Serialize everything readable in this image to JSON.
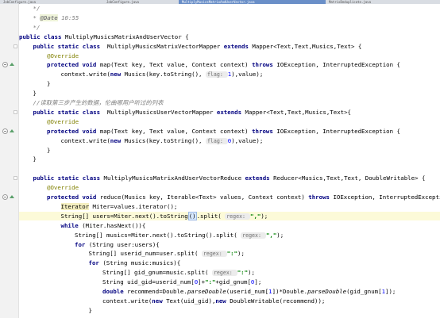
{
  "tabs": [
    {
      "label": "JobConfigure.java",
      "active": false
    },
    {
      "label": "JobConfigure.java",
      "active": false
    },
    {
      "label": "MultiplyMusicsMatrixAndUserVector.java",
      "active": true
    },
    {
      "label": "MatrixDeduplicate.java",
      "active": false
    }
  ],
  "lines": [
    {
      "gutter": "",
      "fold": false,
      "hl": false,
      "indent": 1,
      "tokens": [
        {
          "t": "*/",
          "c": "doc"
        }
      ]
    },
    {
      "gutter": "",
      "fold": false,
      "hl": false,
      "indent": 1,
      "tokens": [
        {
          "t": "* ",
          "c": "doc"
        },
        {
          "t": "@Date",
          "c": "doctag"
        },
        {
          "t": " 10:55",
          "c": "doc"
        }
      ]
    },
    {
      "gutter": "",
      "fold": false,
      "hl": false,
      "indent": 1,
      "tokens": [
        {
          "t": "*/",
          "c": "doc"
        }
      ]
    },
    {
      "gutter": "",
      "fold": false,
      "hl": false,
      "indent": 0,
      "tokens": [
        {
          "t": "public class ",
          "c": "kw"
        },
        {
          "t": "MultiplyMusicsMatrixAndUserVector {",
          "c": ""
        }
      ]
    },
    {
      "gutter": "",
      "fold": false,
      "hl": false,
      "indent": 1,
      "tokens": [
        {
          "t": "public static class ",
          "c": "kw"
        },
        {
          "t": " MultiplyMusicsMatrixVectorMapper ",
          "c": ""
        },
        {
          "t": "extends ",
          "c": "kw"
        },
        {
          "t": "Mapper<Text,Text,Musics,Text> {",
          "c": ""
        }
      ]
    },
    {
      "gutter": "",
      "fold": false,
      "hl": false,
      "indent": 2,
      "tokens": [
        {
          "t": "@Override",
          "c": "ann"
        }
      ]
    },
    {
      "gutter": "override",
      "fold": false,
      "hl": false,
      "indent": 2,
      "tokens": [
        {
          "t": "protected void ",
          "c": "kw"
        },
        {
          "t": "map(Text key, Text value, Context context) ",
          "c": ""
        },
        {
          "t": "throws ",
          "c": "kw"
        },
        {
          "t": "IOException, InterruptedException {",
          "c": ""
        }
      ]
    },
    {
      "gutter": "",
      "fold": false,
      "hl": false,
      "indent": 3,
      "tokens": [
        {
          "t": "context.write(",
          "c": ""
        },
        {
          "t": "new ",
          "c": "kw"
        },
        {
          "t": "Musics(key.toString(), ",
          "c": ""
        },
        {
          "t": "flag: ",
          "c": "hint"
        },
        {
          "t": "1",
          "c": "num"
        },
        {
          "t": "),value);",
          "c": ""
        }
      ]
    },
    {
      "gutter": "",
      "fold": false,
      "hl": false,
      "indent": 2,
      "tokens": [
        {
          "t": "}",
          "c": ""
        }
      ]
    },
    {
      "gutter": "",
      "fold": false,
      "hl": false,
      "indent": 1,
      "tokens": [
        {
          "t": "}",
          "c": ""
        }
      ]
    },
    {
      "gutter": "",
      "fold": false,
      "hl": false,
      "indent": 1,
      "tokens": [
        {
          "t": "//读取第三步产生的数据，伦曲哪用户听过的列表",
          "c": "cm"
        }
      ]
    },
    {
      "gutter": "",
      "fold": false,
      "hl": false,
      "indent": 1,
      "tokens": [
        {
          "t": "public static class ",
          "c": "kw"
        },
        {
          "t": " MultiplyMusicsUserVectorMapper ",
          "c": ""
        },
        {
          "t": "extends ",
          "c": "kw"
        },
        {
          "t": "Mapper<Text,Text,Musics,Text>{",
          "c": ""
        }
      ]
    },
    {
      "gutter": "",
      "fold": false,
      "hl": false,
      "indent": 2,
      "tokens": [
        {
          "t": "@Override",
          "c": "ann"
        }
      ]
    },
    {
      "gutter": "override",
      "fold": false,
      "hl": false,
      "indent": 2,
      "tokens": [
        {
          "t": "protected void ",
          "c": "kw"
        },
        {
          "t": "map(Text key, Text value, Context context) ",
          "c": ""
        },
        {
          "t": "throws ",
          "c": "kw"
        },
        {
          "t": "IOException, InterruptedException {",
          "c": ""
        }
      ]
    },
    {
      "gutter": "",
      "fold": false,
      "hl": false,
      "indent": 3,
      "tokens": [
        {
          "t": "context.write(",
          "c": ""
        },
        {
          "t": "new ",
          "c": "kw"
        },
        {
          "t": "Musics(key.toString(), ",
          "c": ""
        },
        {
          "t": "flag: ",
          "c": "hint"
        },
        {
          "t": "0",
          "c": "num"
        },
        {
          "t": "),value);",
          "c": ""
        }
      ]
    },
    {
      "gutter": "",
      "fold": false,
      "hl": false,
      "indent": 2,
      "tokens": [
        {
          "t": "}",
          "c": ""
        }
      ]
    },
    {
      "gutter": "",
      "fold": false,
      "hl": false,
      "indent": 1,
      "tokens": [
        {
          "t": "}",
          "c": ""
        }
      ]
    },
    {
      "gutter": "",
      "fold": false,
      "hl": false,
      "indent": 0,
      "tokens": []
    },
    {
      "gutter": "",
      "fold": false,
      "hl": false,
      "indent": 1,
      "tokens": [
        {
          "t": "public static class ",
          "c": "kw"
        },
        {
          "t": "MultiplyMusicsMatrixAndUserVectorReduce ",
          "c": ""
        },
        {
          "t": "extends ",
          "c": "kw"
        },
        {
          "t": "Reducer<Musics,Text,Text, DoubleWritable> {",
          "c": ""
        }
      ]
    },
    {
      "gutter": "",
      "fold": false,
      "hl": false,
      "indent": 2,
      "tokens": [
        {
          "t": "@Override",
          "c": "ann"
        }
      ]
    },
    {
      "gutter": "override",
      "fold": false,
      "hl": false,
      "indent": 2,
      "tokens": [
        {
          "t": "protected void ",
          "c": "kw"
        },
        {
          "t": "reduce(Musics key, Iterable<Text> values, Context context) ",
          "c": ""
        },
        {
          "t": "throws ",
          "c": "kw"
        },
        {
          "t": "IOException, InterruptedException",
          "c": ""
        }
      ]
    },
    {
      "gutter": "",
      "fold": false,
      "hl": false,
      "indent": 3,
      "tokens": [
        {
          "t": "Iterator",
          "c": "mark"
        },
        {
          "t": " Miter=values.iterator();",
          "c": ""
        }
      ]
    },
    {
      "gutter": "",
      "fold": false,
      "hl": true,
      "indent": 3,
      "tokens": [
        {
          "t": "String[] users=Miter.next().toString",
          "c": ""
        },
        {
          "t": "()",
          "c": "caretbox"
        },
        {
          "t": ".split( ",
          "c": ""
        },
        {
          "t": "regex: ",
          "c": "hint"
        },
        {
          "t": "\",\"",
          "c": "str"
        },
        {
          "t": ");",
          "c": ""
        }
      ]
    },
    {
      "gutter": "",
      "fold": false,
      "hl": false,
      "indent": 3,
      "tokens": [
        {
          "t": "while ",
          "c": "kw"
        },
        {
          "t": "(Miter.hasNext()){",
          "c": ""
        }
      ]
    },
    {
      "gutter": "",
      "fold": false,
      "hl": false,
      "indent": 4,
      "tokens": [
        {
          "t": "String[] musics=Miter.next().toString().split( ",
          "c": ""
        },
        {
          "t": "regex: ",
          "c": "hint"
        },
        {
          "t": "\",\"",
          "c": "str"
        },
        {
          "t": ");",
          "c": ""
        }
      ]
    },
    {
      "gutter": "",
      "fold": false,
      "hl": false,
      "indent": 4,
      "tokens": [
        {
          "t": "for ",
          "c": "kw"
        },
        {
          "t": "(String user:users){",
          "c": ""
        }
      ]
    },
    {
      "gutter": "",
      "fold": false,
      "hl": false,
      "indent": 5,
      "tokens": [
        {
          "t": "String[] userid_num=user.split( ",
          "c": ""
        },
        {
          "t": "regex: ",
          "c": "hint"
        },
        {
          "t": "\":\"",
          "c": "str"
        },
        {
          "t": ");",
          "c": ""
        }
      ]
    },
    {
      "gutter": "",
      "fold": false,
      "hl": false,
      "indent": 5,
      "tokens": [
        {
          "t": "for ",
          "c": "kw"
        },
        {
          "t": "(String music:musics){",
          "c": ""
        }
      ]
    },
    {
      "gutter": "",
      "fold": false,
      "hl": false,
      "indent": 6,
      "tokens": [
        {
          "t": "String[] gid_gnum=music.split( ",
          "c": ""
        },
        {
          "t": "regex: ",
          "c": "hint"
        },
        {
          "t": "\":\"",
          "c": "str"
        },
        {
          "t": ");",
          "c": ""
        }
      ]
    },
    {
      "gutter": "",
      "fold": false,
      "hl": false,
      "indent": 6,
      "tokens": [
        {
          "t": "String uid_gid=userid_num[",
          "c": ""
        },
        {
          "t": "0",
          "c": "num"
        },
        {
          "t": "]+",
          "c": ""
        },
        {
          "t": "\":\"",
          "c": "str"
        },
        {
          "t": "+gid_gnum[",
          "c": ""
        },
        {
          "t": "0",
          "c": "num"
        },
        {
          "t": "];",
          "c": ""
        }
      ]
    },
    {
      "gutter": "",
      "fold": false,
      "hl": false,
      "indent": 6,
      "tokens": [
        {
          "t": "double ",
          "c": "kw"
        },
        {
          "t": "recommend=Double.",
          "c": ""
        },
        {
          "t": "parseDouble",
          "c": "st"
        },
        {
          "t": "(userid_num[",
          "c": ""
        },
        {
          "t": "1",
          "c": "num"
        },
        {
          "t": "])*Double.",
          "c": ""
        },
        {
          "t": "parseDouble",
          "c": "st"
        },
        {
          "t": "(gid_gnum[",
          "c": ""
        },
        {
          "t": "1",
          "c": "num"
        },
        {
          "t": "]);",
          "c": ""
        }
      ]
    },
    {
      "gutter": "",
      "fold": false,
      "hl": false,
      "indent": 6,
      "tokens": [
        {
          "t": "context.write(",
          "c": ""
        },
        {
          "t": "new ",
          "c": "kw"
        },
        {
          "t": "Text(uid_gid),",
          "c": ""
        },
        {
          "t": "new ",
          "c": "kw"
        },
        {
          "t": "DoubleWritable(recommend));",
          "c": ""
        }
      ]
    },
    {
      "gutter": "",
      "fold": false,
      "hl": false,
      "indent": 5,
      "tokens": [
        {
          "t": "}",
          "c": ""
        }
      ]
    }
  ]
}
